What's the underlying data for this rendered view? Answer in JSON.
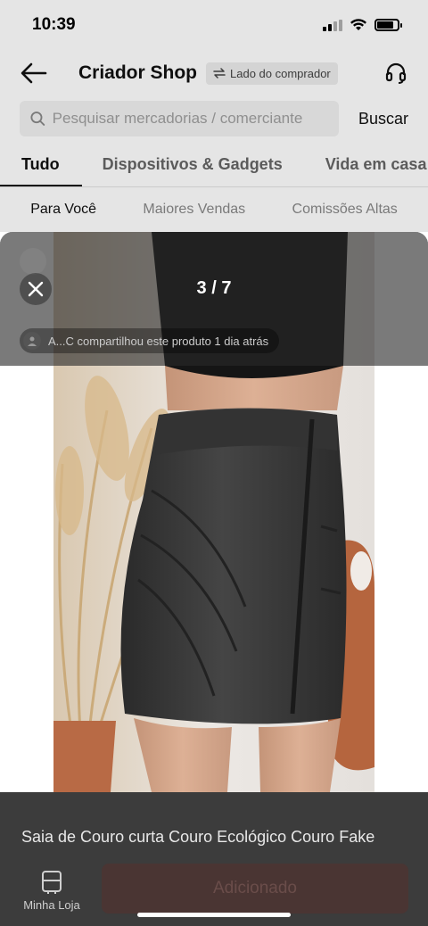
{
  "status_bar": {
    "time": "10:39"
  },
  "header": {
    "title": "Criador Shop",
    "buyer_badge": "Lado do comprador"
  },
  "search": {
    "placeholder": "Pesquisar mercadorias / comerciante",
    "button_label": "Buscar"
  },
  "category_tabs": [
    {
      "label": "Tudo",
      "active": true
    },
    {
      "label": "Dispositivos & Gadgets",
      "active": false
    },
    {
      "label": "Vida em casa",
      "active": false
    }
  ],
  "sub_tabs": [
    {
      "label": "Para Você",
      "active": true
    },
    {
      "label": "Maiores Vendas",
      "active": false
    },
    {
      "label": "Comissões Altas",
      "active": false
    }
  ],
  "viewer": {
    "page_counter": "3 / 7",
    "share_text": "A...C compartilhou este produto 1 dia atrás",
    "product_title": "Saia de Couro curta Couro Ecológico Couro Fake",
    "store_label": "Minha Loja",
    "add_button_label": "Adicionado"
  },
  "icons": {
    "back": "arrow-left-icon",
    "swap": "swap-arrows-icon",
    "support": "headset-icon",
    "search": "search-icon",
    "close": "close-icon",
    "store": "store-icon",
    "avatar": "user-avatar-icon"
  },
  "colors": {
    "viewer_overlay": "#3a3a3a",
    "add_button_bg": "#4a3533",
    "active_tab": "#111111",
    "inactive_tab": "#666666"
  }
}
